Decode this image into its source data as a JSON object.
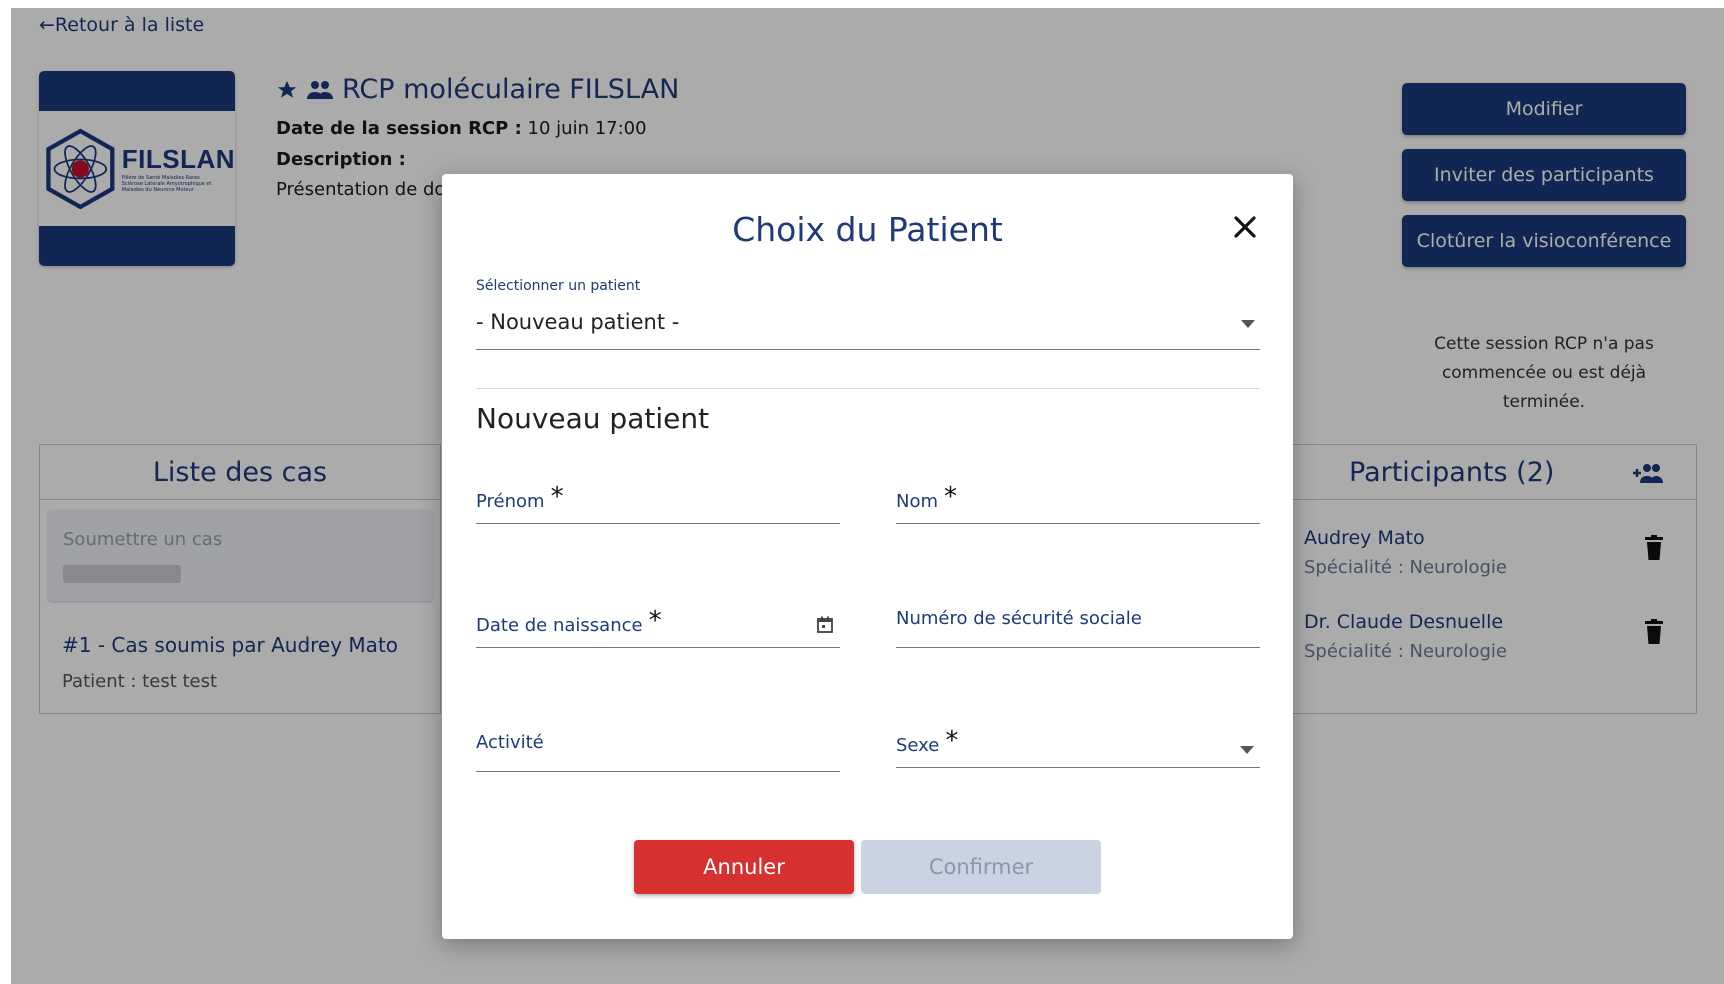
{
  "header": {
    "back_link": "←Retour à la liste",
    "logo_text": "FILSLAN",
    "logo_subtext": "Filière de Santé Maladies Rares Sclérose Latérale Amyotrophique et Maladies du Neurone Moteur",
    "title": "RCP moléculaire FILSLAN",
    "date_label": "Date de la session RCP :",
    "date_value": "10 juin 17:00",
    "description_label": "Description :",
    "description_value": "Présentation de dos"
  },
  "actions": {
    "edit_label": "Modifier",
    "invite_label": "Inviter des participants",
    "close_visio_label": "Clotûrer la visioconférence",
    "status_note": "Cette session RCP n'a pas commencée ou est déjà terminée."
  },
  "cases": {
    "title": "Liste des cas",
    "submit_placeholder": "Soumettre un cas",
    "items": [
      {
        "title": "#1 - Cas soumis par Audrey Mato",
        "patient": "Patient : test test"
      }
    ]
  },
  "participants": {
    "title": "Participants (2)",
    "items": [
      {
        "name": "Audrey Mato",
        "specialty": "Spécialité : Neurologie"
      },
      {
        "name": "Dr. Claude Desnuelle",
        "specialty": "Spécialité : Neurologie"
      }
    ]
  },
  "modal": {
    "title": "Choix du Patient",
    "select_label": "Sélectionner un patient",
    "select_value": "- Nouveau patient -",
    "section_title": "Nouveau patient",
    "required_mark": "*",
    "fields": {
      "first_name": "Prénom",
      "last_name": "Nom",
      "birth_date": "Date de naissance",
      "ssn": "Numéro de sécurité sociale",
      "activity": "Activité",
      "sex": "Sexe"
    },
    "cancel_label": "Annuler",
    "confirm_label": "Confirmer"
  },
  "colors": {
    "brand": "#1c3a7c",
    "cancel": "#d63031",
    "disabled": "#c9d3e2"
  }
}
